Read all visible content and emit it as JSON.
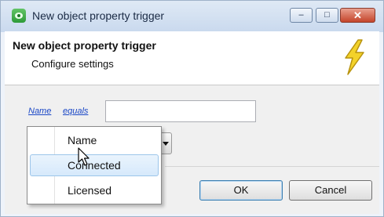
{
  "window": {
    "title": "New object property trigger",
    "minimize_glyph": "–",
    "maximize_glyph": "□",
    "close_glyph": "✕"
  },
  "header": {
    "title": "New object property trigger",
    "subtitle": "Configure settings",
    "icon": "lightning-bolt-icon"
  },
  "form": {
    "field_link": "Name",
    "operator_link": "equals",
    "value": ""
  },
  "dropdown": {
    "options": [
      "Name",
      "Connected",
      "Licensed"
    ],
    "highlighted_index": 1
  },
  "buttons": {
    "ok": "OK",
    "cancel": "Cancel"
  },
  "colors": {
    "link": "#1a47c6",
    "highlight": "#d6e9fb",
    "close_button": "#c4442a",
    "bolt": "#f3d22a"
  }
}
